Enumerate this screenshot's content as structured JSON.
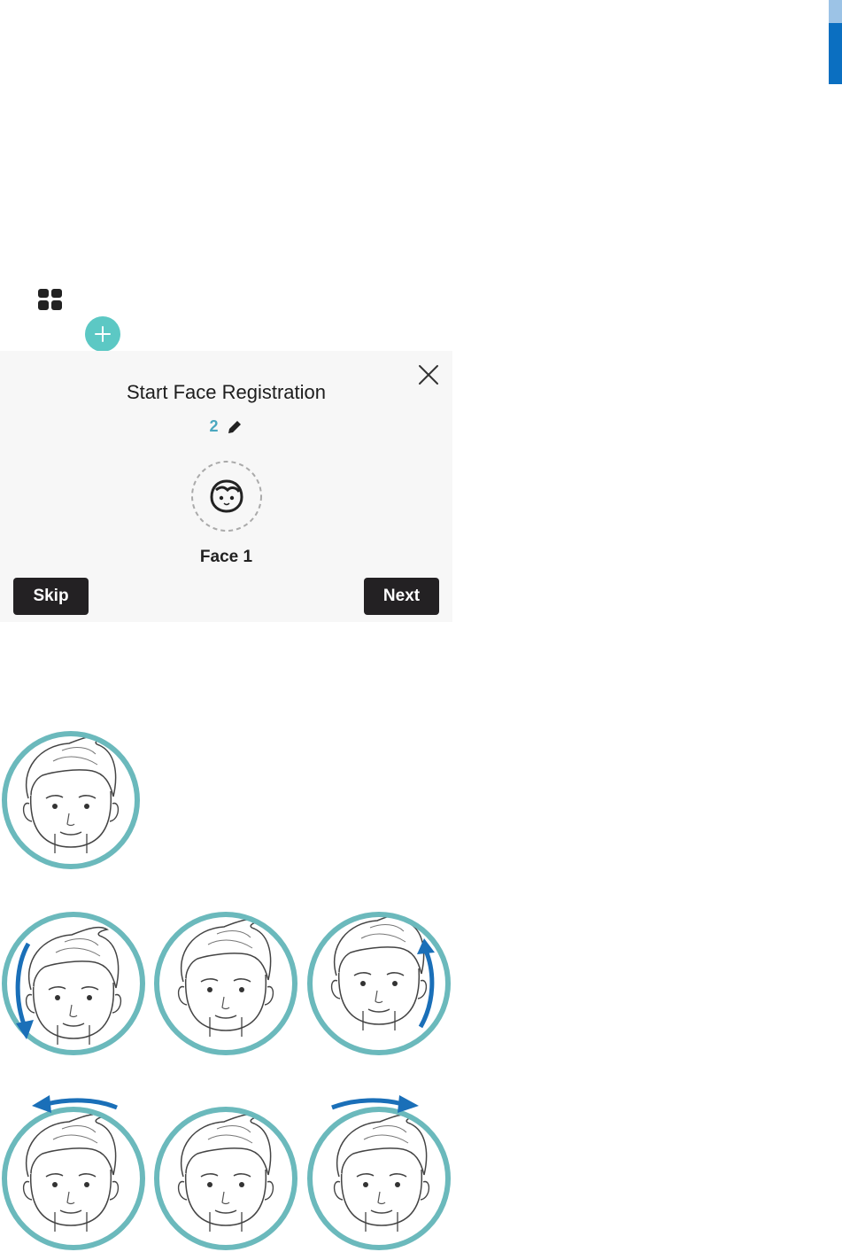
{
  "dialog": {
    "title": "Start Face Registration",
    "count": "2",
    "face_label": "Face 1",
    "skip_label": "Skip",
    "next_label": "Next"
  },
  "icons": {
    "grid": "grid-icon",
    "add": "plus-icon",
    "close": "close-icon",
    "edit": "pencil-icon",
    "face": "face-icon",
    "arrow": "arrow-icon"
  },
  "colors": {
    "accent_teal": "#5cc8c4",
    "ring_teal": "#6bb9bc",
    "count_blue": "#4aa7bf",
    "arrow_blue": "#1a6fb8",
    "button_dark": "#232123",
    "side_tab_blue": "#0b6fc1"
  },
  "illustrations": {
    "front": "front-face",
    "rows": [
      [
        "tilt-down-face",
        "front-face",
        "tilt-up-face"
      ],
      [
        "turn-left-face",
        "front-face",
        "turn-right-face"
      ]
    ]
  }
}
